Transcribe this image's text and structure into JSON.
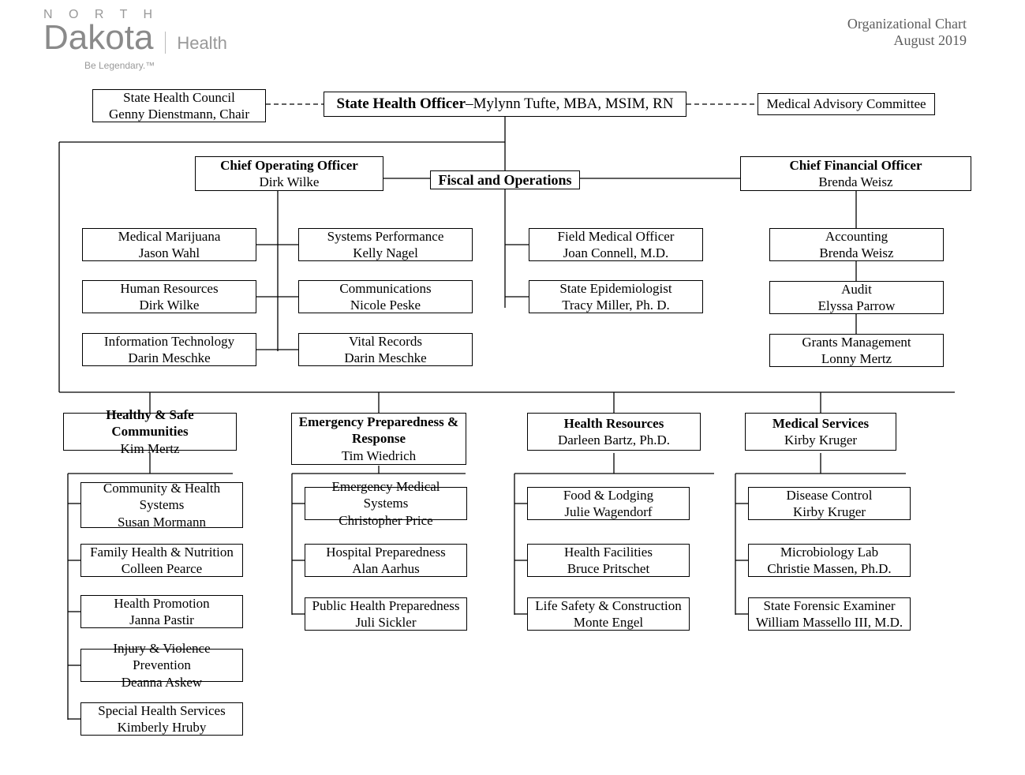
{
  "header": {
    "title": "Organizational Chart",
    "date": "August 2019",
    "logo": {
      "north": "N  O  R  T  H",
      "dakota": "Dakota",
      "health": "Health",
      "tagline": "Be Legendary.™"
    }
  },
  "top": {
    "sho_title": "State Health Officer",
    "sho_rest": "–Mylynn Tufte, MBA, MSIM, RN",
    "council_t": "State Health Council",
    "council_p": "Genny Dienstmann, Chair",
    "advisory": "Medical Advisory Committee"
  },
  "mid": {
    "coo_t": "Chief Operating Officer",
    "coo_p": "Dirk Wilke",
    "fo": "Fiscal and Operations",
    "cfo_t": "Chief Financial Officer",
    "cfo_p": "Brenda Weisz"
  },
  "coo_units": {
    "mm_t": "Medical Marijuana",
    "mm_p": "Jason Wahl",
    "hr_t": "Human Resources",
    "hr_p": "Dirk Wilke",
    "it_t": "Information Technology",
    "it_p": "Darin Meschke",
    "sp_t": "Systems Performance",
    "sp_p": "Kelly Nagel",
    "com_t": "Communications",
    "com_p": "Nicole Peske",
    "vr_t": "Vital Records",
    "vr_p": "Darin Meschke"
  },
  "fo_units": {
    "fmo_t": "Field Medical Officer",
    "fmo_p": "Joan Connell, M.D.",
    "se_t": "State Epidemiologist",
    "se_p": "Tracy Miller, Ph. D."
  },
  "cfo_units": {
    "acc_t": "Accounting",
    "acc_p": "Brenda Weisz",
    "aud_t": "Audit",
    "aud_p": "Elyssa Parrow",
    "gm_t": "Grants Management",
    "gm_p": "Lonny Mertz"
  },
  "divisions": {
    "hsc_t": "Healthy & Safe Communities",
    "hsc_p": "Kim Mertz",
    "epr_t": "Emergency Preparedness & Response",
    "epr_p": "Tim Wiedrich",
    "hres_t": "Health Resources",
    "hres_p": "Darleen Bartz, Ph.D.",
    "ms_t": "Medical Services",
    "ms_p": "Kirby Kruger"
  },
  "hsc": {
    "chs_t": "Community & Health Systems",
    "chs_p": "Susan Mormann",
    "fhn_t": "Family Health & Nutrition",
    "fhn_p": "Colleen Pearce",
    "hp_t": "Health Promotion",
    "hp_p": "Janna Pastir",
    "ivp_t": "Injury & Violence Prevention",
    "ivp_p": "Deanna Askew",
    "shs_t": "Special Health Services",
    "shs_p": "Kimberly Hruby"
  },
  "epr": {
    "ems_t": "Emergency Medical Systems",
    "ems_p": "Christopher Price",
    "hosp_t": "Hospital Preparedness",
    "hosp_p": "Alan Aarhus",
    "php_t": "Public Health Preparedness",
    "php_p": "Juli Sickler"
  },
  "hres": {
    "fl_t": "Food & Lodging",
    "fl_p": "Julie Wagendorf",
    "hf_t": "Health Facilities",
    "hf_p": "Bruce Pritschet",
    "lsc_t": "Life Safety & Construction",
    "lsc_p": "Monte Engel"
  },
  "ms": {
    "dc_t": "Disease Control",
    "dc_p": "Kirby Kruger",
    "ml_t": "Microbiology Lab",
    "ml_p": "Christie Massen, Ph.D.",
    "sfe_t": "State Forensic Examiner",
    "sfe_p": "William Massello III, M.D."
  }
}
